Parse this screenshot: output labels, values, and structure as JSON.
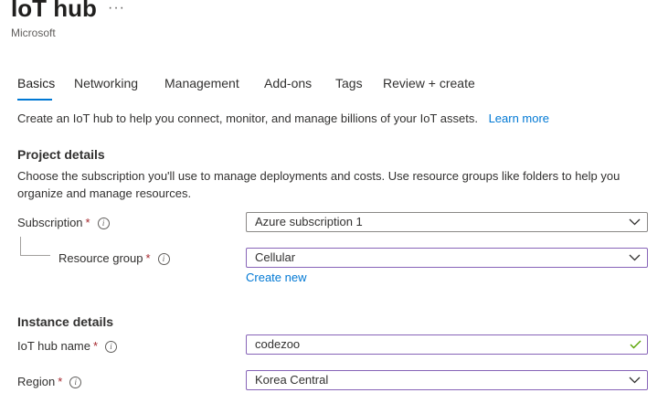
{
  "header": {
    "title": "IoT hub",
    "more": "···",
    "publisher": "Microsoft"
  },
  "tabs": [
    {
      "label": "Basics",
      "active": true
    },
    {
      "label": "Networking"
    },
    {
      "label": "Management"
    },
    {
      "label": "Add-ons"
    },
    {
      "label": "Tags"
    },
    {
      "label": "Review + create"
    }
  ],
  "intro": {
    "text": "Create an IoT hub to help you connect, monitor, and manage billions of your IoT assets.",
    "link": "Learn more"
  },
  "project": {
    "heading": "Project details",
    "description": "Choose the subscription you'll use to manage deployments and costs. Use resource groups like folders to help you organize and manage resources.",
    "subscription": {
      "label": "Subscription",
      "required": "*",
      "value": "Azure subscription 1"
    },
    "resource_group": {
      "label": "Resource group",
      "required": "*",
      "value": "Cellular",
      "create_new": "Create new"
    }
  },
  "instance": {
    "heading": "Instance details",
    "hub_name": {
      "label": "IoT hub name",
      "required": "*",
      "value": "codezoo"
    },
    "region": {
      "label": "Region",
      "required": "*",
      "value": "Korea Central"
    }
  },
  "colors": {
    "accent": "#0078d4",
    "required": "#a4262c",
    "focus_border": "#8764b8",
    "valid_check": "#57a300"
  },
  "icons": {
    "info": "info-icon",
    "dropdown": "chevron-down-icon",
    "valid": "checkmark-icon",
    "more": "more-icon"
  }
}
